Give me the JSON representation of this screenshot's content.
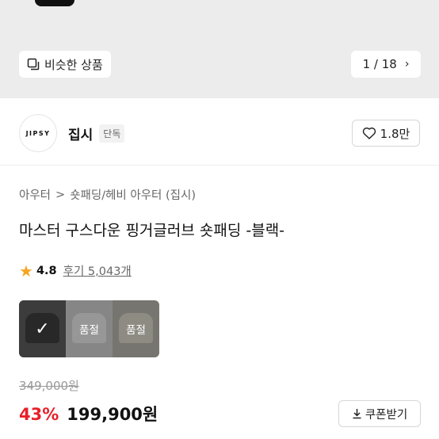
{
  "hero": {
    "similar_label": "비슷한 상품",
    "pager_current": "1",
    "pager_sep": "/",
    "pager_total": "18",
    "pager_next_icon": "chevron-right-icon"
  },
  "brand": {
    "logo_text": "JIPSY",
    "name": "집시",
    "badge": "단독",
    "like_count": "1.8만"
  },
  "breadcrumb": {
    "items": [
      "아우터",
      "숏패딩/헤비 아우터 (집시)"
    ]
  },
  "product": {
    "title": "마스터 구스다운 핑거글러브 숏패딩 -블랙-",
    "rating": "4.8",
    "reviews": "후기 5,043개",
    "options": [
      {
        "state": "selected",
        "label": ""
      },
      {
        "state": "soldout",
        "label": "품절"
      },
      {
        "state": "soldout",
        "label": "품절"
      }
    ],
    "original_price": "349,000원",
    "discount": "43%",
    "sale_price": "199,900원",
    "coupon_label": "쿠폰받기"
  },
  "colors": {
    "discount": "#e8202a",
    "star": "#f6a623"
  }
}
